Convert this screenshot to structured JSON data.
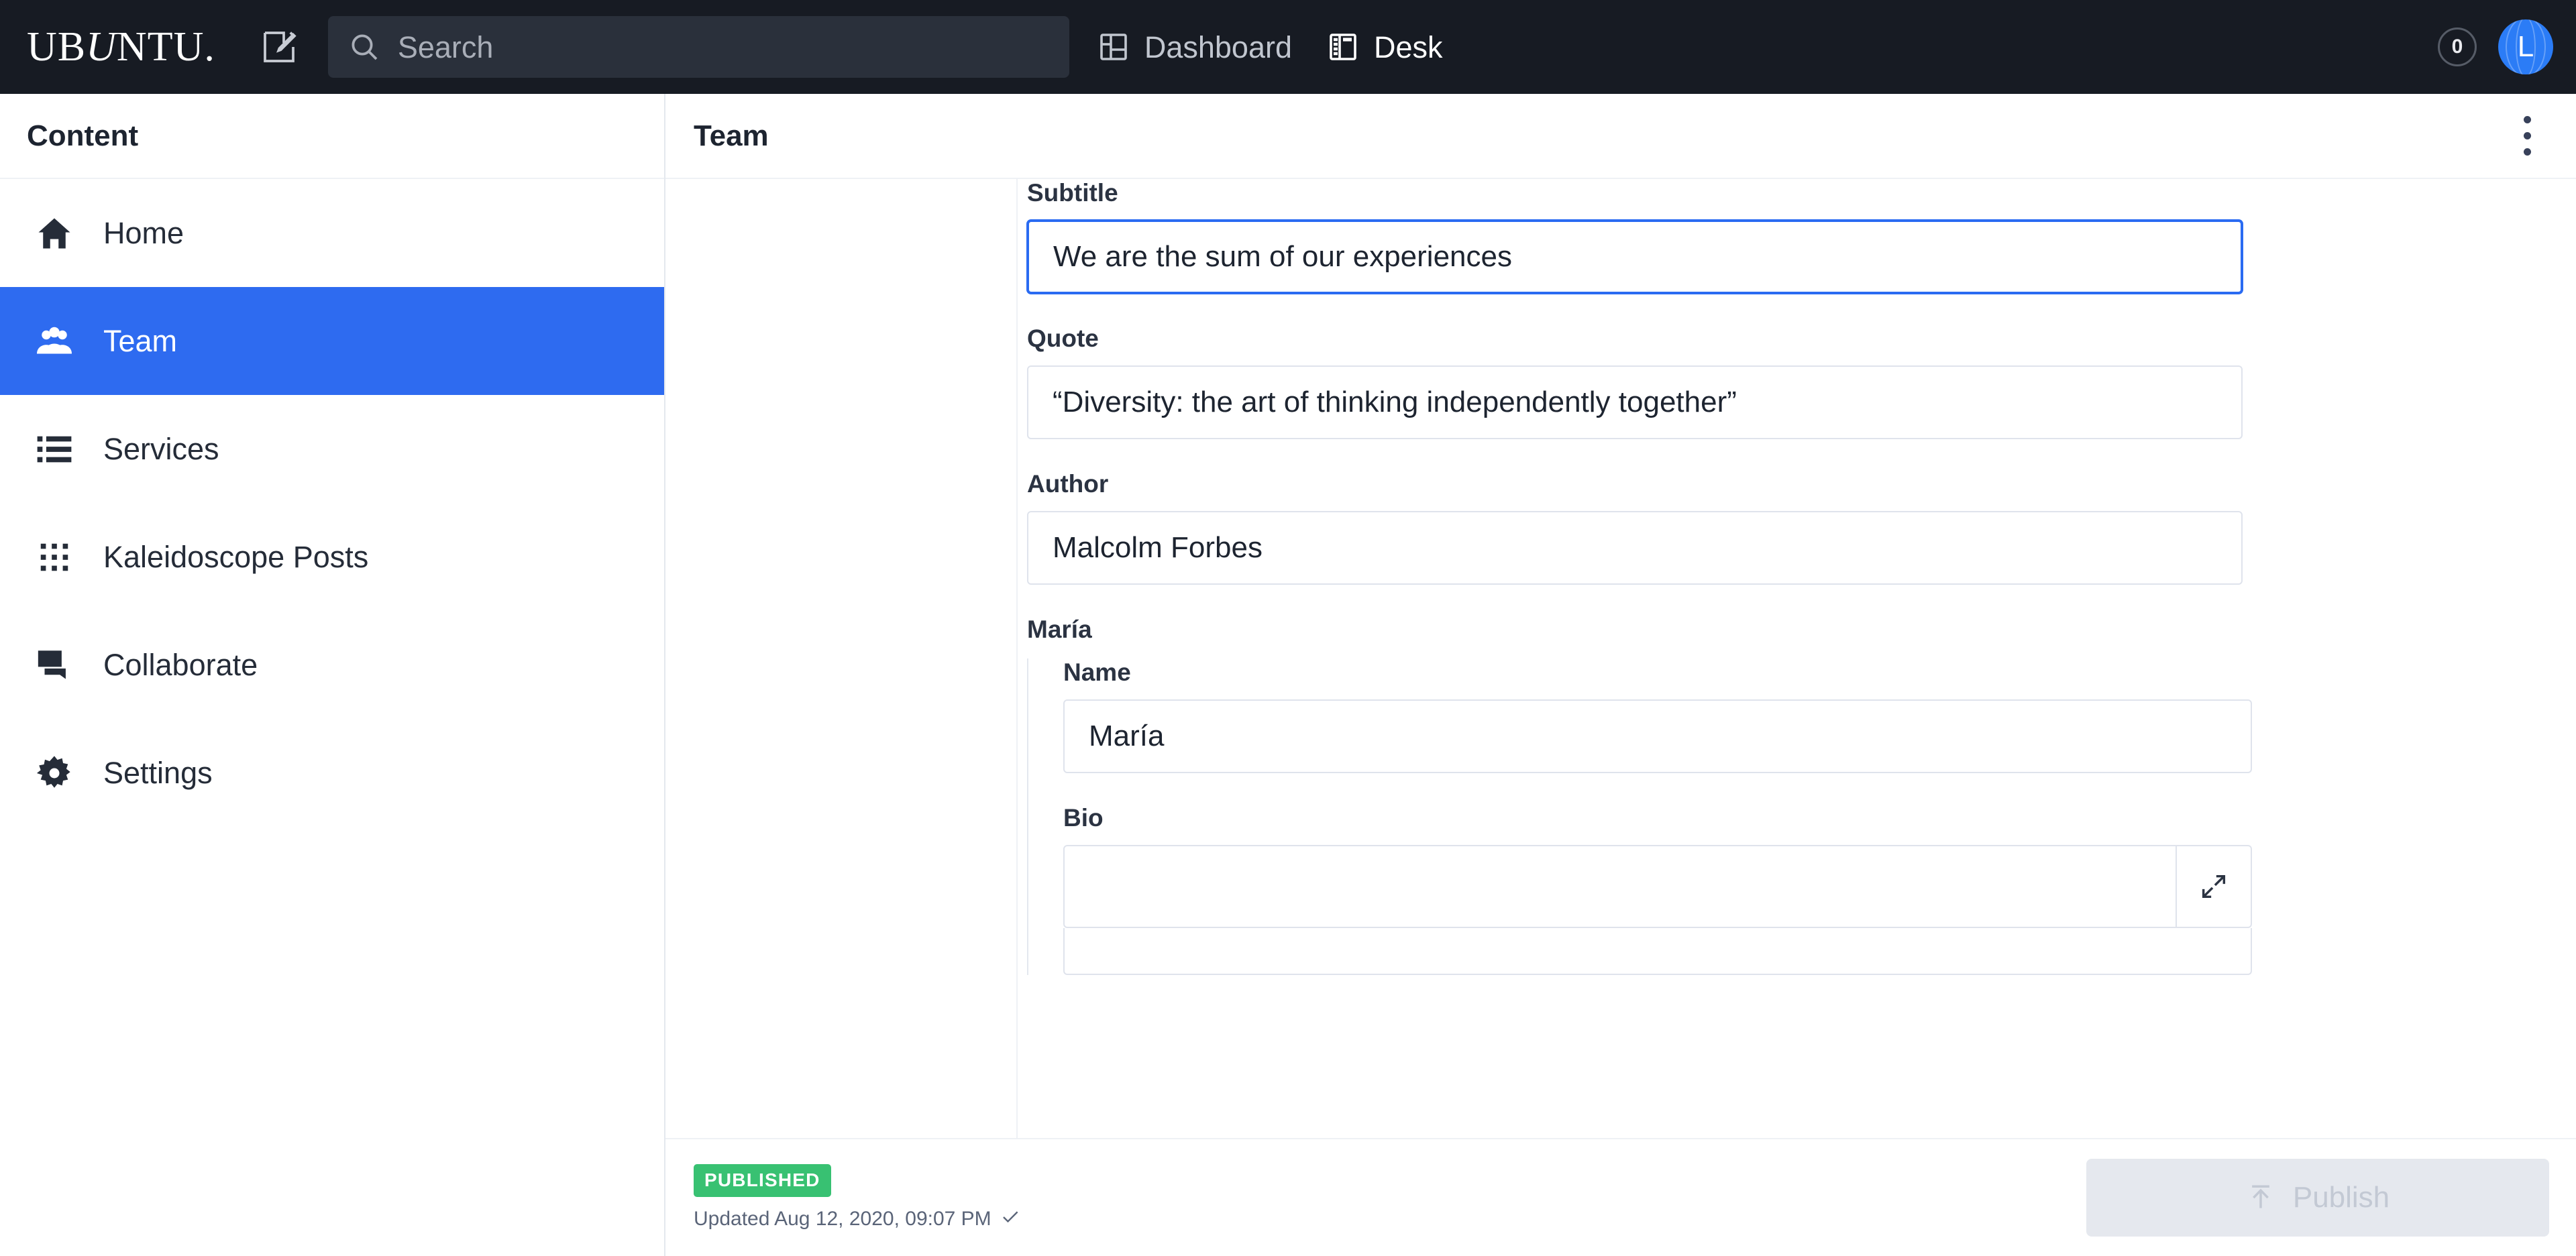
{
  "topbar": {
    "logo_main": "UB",
    "logo_slant": "U",
    "logo_tail": "NTU.",
    "compose_icon": "compose-pencil-icon",
    "search": {
      "icon": "search-icon",
      "placeholder": "Search",
      "value": ""
    },
    "nav": [
      {
        "label": "Dashboard",
        "icon": "dashboard-grid-icon",
        "active": false
      },
      {
        "label": "Desk",
        "icon": "desk-panel-icon",
        "active": true
      }
    ],
    "notification_count": "0",
    "avatar_initial": "L",
    "accent_blue": "#2b7cf6",
    "bar_bg": "#171b23"
  },
  "sidebar": {
    "header_title": "Content",
    "active_bg": "#2e6bf0",
    "items": [
      {
        "label": "Home",
        "icon": "home-icon"
      },
      {
        "label": "Team",
        "icon": "people-group-icon"
      },
      {
        "label": "Services",
        "icon": "list-bullets-icon"
      },
      {
        "label": "Kaleidoscope Posts",
        "icon": "grid-dots-icon"
      },
      {
        "label": "Collaborate",
        "icon": "chat-bubble-icon"
      },
      {
        "label": "Settings",
        "icon": "gear-icon"
      }
    ],
    "active_index": 1
  },
  "panel": {
    "title": "Team",
    "kebab_icon": "more-vertical-icon"
  },
  "form": {
    "fields": [
      {
        "label": "Subtitle",
        "value": "We are the sum of our experiences",
        "focused": true
      },
      {
        "label": "Quote",
        "value": "“Diversity: the art of thinking independently together”",
        "focused": false
      },
      {
        "label": "Author",
        "value": "Malcolm Forbes",
        "focused": false
      }
    ],
    "group": {
      "label": "María",
      "name_field": {
        "label": "Name",
        "value": "María"
      },
      "bio_field": {
        "label": "Bio",
        "value": "",
        "expand_icon": "expand-diagonal-icon"
      }
    }
  },
  "footer": {
    "status_label": "PUBLISHED",
    "status_color": "#38c172",
    "updated_text": "Updated Aug 12, 2020, 09:07 PM",
    "updated_check_icon": "check-icon",
    "publish_label": "Publish",
    "publish_icon": "upload-arrow-icon",
    "publish_disabled": true
  }
}
